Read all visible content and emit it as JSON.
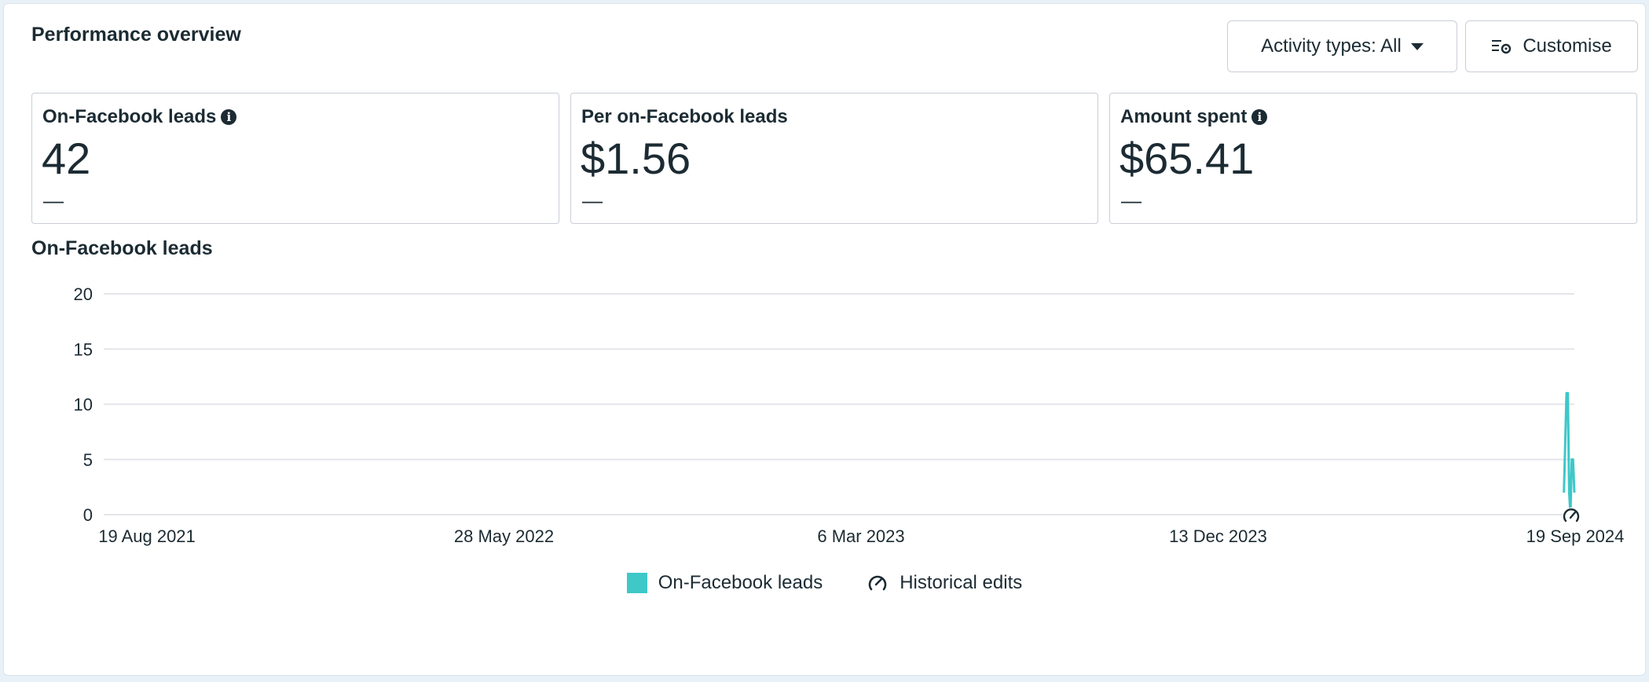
{
  "header": {
    "title": "Performance overview",
    "activity_button": "Activity types: All",
    "customise_button": "Customise"
  },
  "cards": [
    {
      "label": "On-Facebook leads",
      "value": "42",
      "delta": "—",
      "has_info": true
    },
    {
      "label": "Per on-Facebook leads",
      "value": "$1.56",
      "delta": "—",
      "has_info": false
    },
    {
      "label": "Amount spent",
      "value": "$65.41",
      "delta": "—",
      "has_info": true
    }
  ],
  "chart": {
    "title": "On-Facebook leads",
    "legend": {
      "series": "On-Facebook leads",
      "edits": "Historical edits"
    }
  },
  "colors": {
    "series": "#3ec8c8",
    "grid": "#e4e6eb"
  },
  "chart_data": {
    "type": "line",
    "title": "On-Facebook leads",
    "ylim": [
      0,
      20
    ],
    "y_ticks": [
      "0",
      "5",
      "10",
      "15",
      "20"
    ],
    "x_tick_labels": [
      "19 Aug 2021",
      "28 May 2022",
      "6 Mar 2023",
      "13 Dec 2023",
      "19 Sep 2024"
    ],
    "xlim": [
      "2021-08-19",
      "2024-09-19"
    ],
    "series": [
      {
        "name": "On-Facebook leads",
        "points": [
          {
            "x": "2024-09-11",
            "y": 2
          },
          {
            "x": "2024-09-13",
            "y": 11
          },
          {
            "x": "2024-09-14",
            "y": 11
          },
          {
            "x": "2024-09-15",
            "y": 2
          },
          {
            "x": "2024-09-16",
            "y": 0
          },
          {
            "x": "2024-09-17",
            "y": 5
          },
          {
            "x": "2024-09-18",
            "y": 5
          },
          {
            "x": "2024-09-19",
            "y": 2
          }
        ]
      }
    ],
    "markers": [
      {
        "label": "Historical edits",
        "x": "2024-09-19"
      }
    ],
    "grid": true,
    "legend_position": "bottom-center"
  }
}
